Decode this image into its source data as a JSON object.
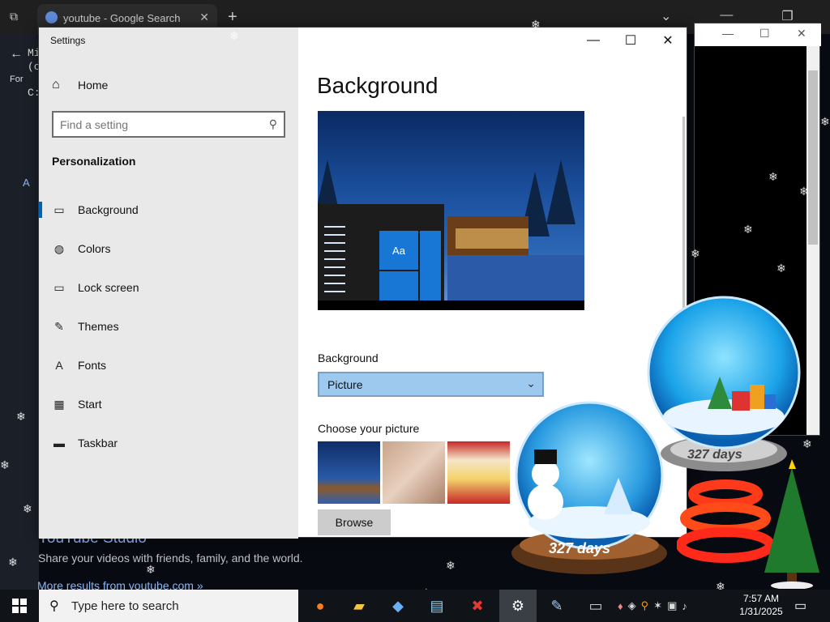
{
  "browser": {
    "tab_title": "youtube - Google Search",
    "tab_close": "✕",
    "new_tab": "+",
    "controls": [
      "⌄",
      "—",
      "❐",
      "✕"
    ],
    "left_glyphs": [
      "Mi",
      "(c",
      "C:",
      "For",
      "A"
    ],
    "result_title": "YouTube Studio",
    "result_desc": "Share your videos with friends, family, and the world.",
    "more_results": "More results from youtube.com »"
  },
  "console": {
    "controls": [
      "—",
      "☐",
      "✕"
    ]
  },
  "settings": {
    "window_title": "Settings",
    "controls": {
      "minimize": "—",
      "maximize": "☐",
      "close": "✕"
    },
    "home_label": "Home",
    "search_placeholder": "Find a setting",
    "section_heading": "Personalization",
    "nav_items": [
      {
        "label": "Background",
        "icon": "picture-icon",
        "glyph": "▭"
      },
      {
        "label": "Colors",
        "icon": "palette-icon",
        "glyph": "◍"
      },
      {
        "label": "Lock screen",
        "icon": "lock-screen-icon",
        "glyph": "▭"
      },
      {
        "label": "Themes",
        "icon": "themes-icon",
        "glyph": "✎"
      },
      {
        "label": "Fonts",
        "icon": "fonts-icon",
        "glyph": "A"
      },
      {
        "label": "Start",
        "icon": "start-icon",
        "glyph": "▦"
      },
      {
        "label": "Taskbar",
        "icon": "taskbar-icon",
        "glyph": "▬"
      }
    ],
    "page_title": "Background",
    "preview_tile_text": "Aa",
    "background_label": "Background",
    "background_value": "Picture",
    "choose_picture_label": "Choose your picture",
    "browse_label": "Browse"
  },
  "widgets": {
    "globe1_days": "327 days",
    "globe2_days": "327 days"
  },
  "taskbar": {
    "search_placeholder": "Type here to search",
    "time": "7:57 AM",
    "date": "1/31/2025",
    "apps": [
      "firefox-icon",
      "file-explorer-icon",
      "app-icon",
      "notepad-icon",
      "stop-icon",
      "settings-icon",
      "paint-icon",
      "terminal-icon"
    ]
  },
  "colors": {
    "accent": "#0063b1",
    "dropdown_bg": "#9ec9ef",
    "taskbar_bg": "#101418"
  }
}
